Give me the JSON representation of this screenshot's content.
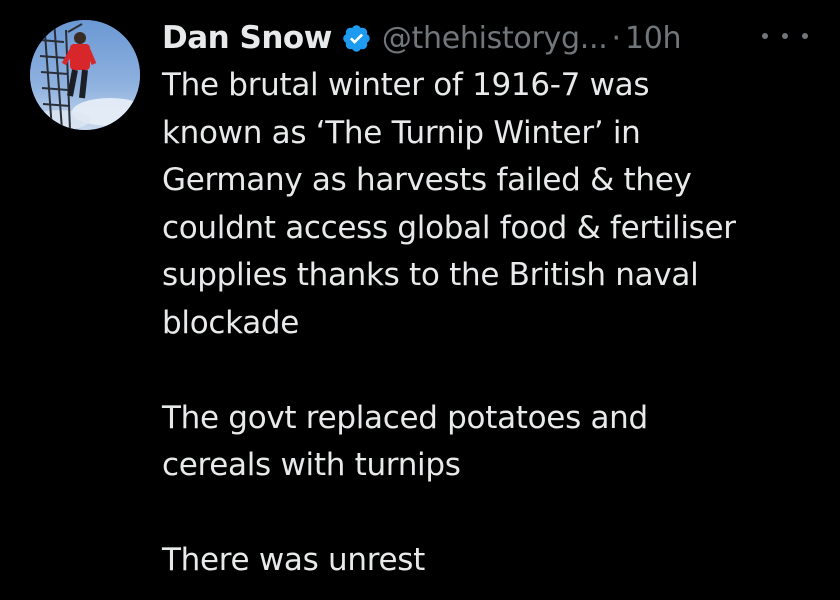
{
  "tweet": {
    "author": {
      "display_name": "Dan Snow",
      "handle": "@thehistoryg...",
      "verified_icon": "verified-badge-icon",
      "avatar_icon": "profile-photo"
    },
    "separator": "·",
    "time": "10h",
    "more_icon": "more-horizontal-icon",
    "paragraphs": [
      {
        "lines": [
          "The brutal winter of 1916-7 was",
          "known as ‘The Turnip Winter’ in",
          "Germany as harvests failed & they",
          "couldnt access global food & fertiliser",
          "supplies thanks to the British naval",
          "blockade"
        ]
      },
      {
        "lines": [
          "The govt replaced potatoes and",
          "cereals with turnips"
        ]
      },
      {
        "lines": [
          "There was unrest"
        ]
      }
    ]
  },
  "colors": {
    "background": "#000000",
    "text": "#e7e9ea",
    "secondary_text": "#71767b",
    "verified": "#1d9bf0"
  }
}
